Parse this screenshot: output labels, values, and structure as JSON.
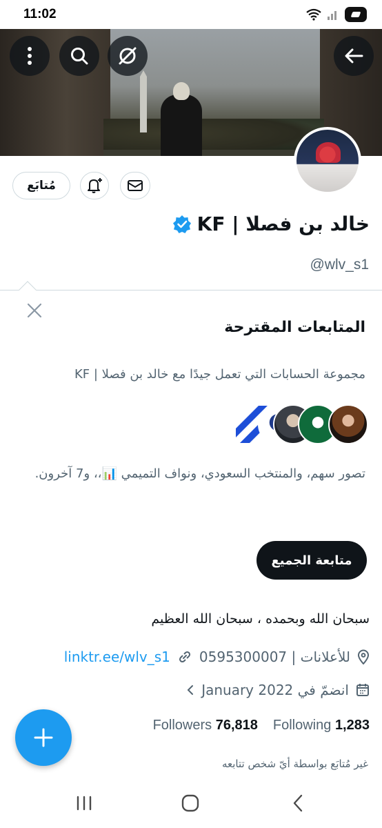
{
  "status_bar": {
    "time": "11:02"
  },
  "banner": {
    "buttons": [
      "more-icon",
      "search-icon",
      "grok-icon",
      "back-arrow-icon"
    ]
  },
  "profile": {
    "display_name": "خالد بن فصلا | KF",
    "handle": "@wlv_s1",
    "follow_label": "مُتابَع",
    "bio": "سبحان الله وبحمده ، سبحان الله العظيم",
    "location": "للأعلانات | 0595300007",
    "link": "linktr.ee/wlv_s1",
    "joined": "انضمّ في January 2022",
    "followers_label": "Followers",
    "followers_count": "76,818",
    "following_label": "Following",
    "following_count": "1,283",
    "not_followed_note": "غير مُتابَع بواسطة أيّ شخص تتابعه"
  },
  "suggestions": {
    "title": "المتابعات المقترحة",
    "subtitle": "مجموعة الحسابات التي تعمل جيدًا مع خالد بن فصلا | KF",
    "names": "تصور سهم، والمنتخب السعودي، ونواف التميمي 📊،، و7 آخرون.",
    "follow_all_label": "متابعة الجميع"
  },
  "colors": {
    "accent": "#1d9bf0",
    "verified": "#1d9bf0",
    "text_secondary": "#536471"
  }
}
